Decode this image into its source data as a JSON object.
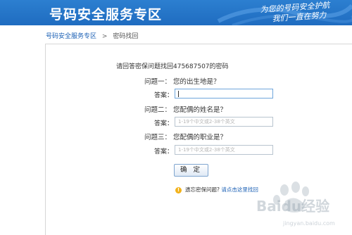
{
  "header": {
    "title": "号码安全服务专区",
    "slogan_line1": "为您的号码安全护航",
    "slogan_line2": "我们一直在努力"
  },
  "breadcrumb": {
    "home": "号码安全服务专区",
    "separator": ">",
    "current": "密码找回"
  },
  "form": {
    "prompt": "请回答密保问题找回475687507的密码",
    "questions": [
      {
        "label": "问题一：",
        "text": "您的出生地是？",
        "answer_label": "答案：",
        "value": "",
        "placeholder": ""
      },
      {
        "label": "问题二：",
        "text": "您配偶的姓名是？",
        "answer_label": "答案：",
        "value": "",
        "placeholder": "1-19个中文或2-38个英文"
      },
      {
        "label": "问题三：",
        "text": "您配偶的职业是？",
        "answer_label": "答案：",
        "value": "",
        "placeholder": "1-19个中文或2-38个英文"
      }
    ],
    "confirm_label": "确 定"
  },
  "help": {
    "icon": "info-icon",
    "text": "遗忘密保问题? ",
    "link": "请点击这里找回"
  },
  "watermark": {
    "brand": "Baidu经验",
    "url": "jingyan.baidu.com"
  },
  "colors": {
    "header_bg": "#1f6cc0",
    "link": "#1a5fb4",
    "accent": "#f2b21b"
  }
}
